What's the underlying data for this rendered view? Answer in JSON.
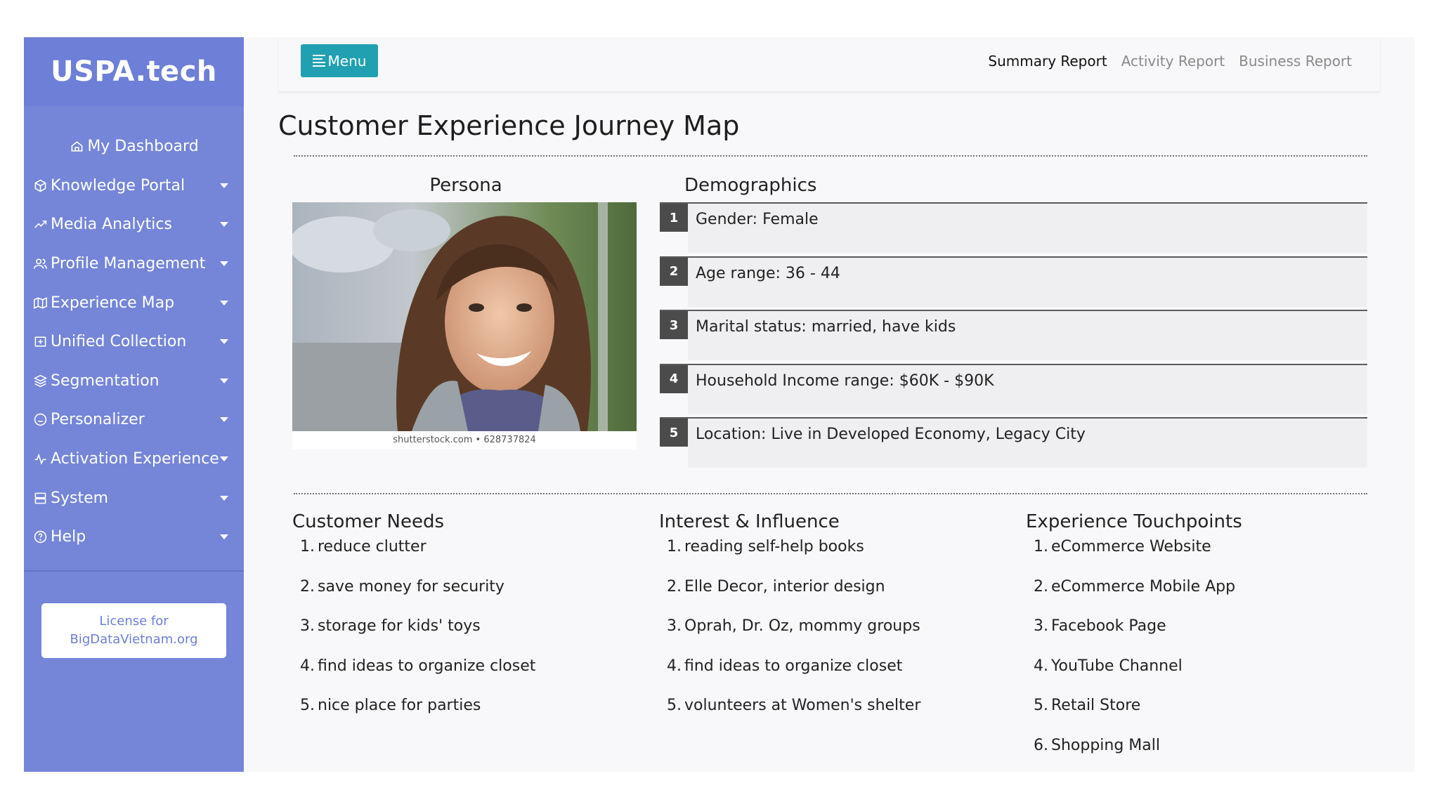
{
  "app": {
    "brand": "USPA.tech"
  },
  "sidebar": {
    "items": [
      {
        "label": "My Dashboard",
        "icon": "home-icon"
      },
      {
        "label": "Knowledge Portal",
        "icon": "cube-icon"
      },
      {
        "label": "Media Analytics",
        "icon": "trending-up-icon"
      },
      {
        "label": "Profile Management",
        "icon": "users-icon"
      },
      {
        "label": "Experience Map",
        "icon": "map-icon"
      },
      {
        "label": "Unified Collection",
        "icon": "collection-icon"
      },
      {
        "label": "Segmentation",
        "icon": "layers-icon"
      },
      {
        "label": "Personalizer",
        "icon": "smile-icon"
      },
      {
        "label": "Activation Experience",
        "icon": "activity-icon"
      },
      {
        "label": "System",
        "icon": "server-icon"
      },
      {
        "label": "Help",
        "icon": "help-icon"
      }
    ],
    "license": {
      "line1": "License for",
      "line2": "BigDataVietnam.org"
    }
  },
  "topbar": {
    "menu_label": "Menu",
    "tabs": [
      {
        "label": "Summary Report",
        "active": true
      },
      {
        "label": "Activity Report",
        "active": false
      },
      {
        "label": "Business Report",
        "active": false
      }
    ]
  },
  "main": {
    "title": "Customer Experience Journey Map",
    "persona": {
      "title": "Persona",
      "credit": "shutterstock.com • 628737824"
    },
    "demographics": {
      "title": "Demographics",
      "items": [
        {
          "num": "1",
          "text": "Gender: Female"
        },
        {
          "num": "2",
          "text": "Age range: 36 - 44"
        },
        {
          "num": "3",
          "text": "Marital status: married, have kids"
        },
        {
          "num": "4",
          "text": "Household Income range: $60K - $90K"
        },
        {
          "num": "5",
          "text": "Location: Live in Developed Economy, Legacy City"
        }
      ]
    },
    "needs": {
      "title": "Customer Needs",
      "items": [
        {
          "n": "1.",
          "text": "reduce clutter"
        },
        {
          "n": "2.",
          "text": "save money for security"
        },
        {
          "n": "3.",
          "text": "storage for kids' toys"
        },
        {
          "n": "4.",
          "text": "find ideas to organize closet"
        },
        {
          "n": "5.",
          "text": "nice place for parties"
        }
      ]
    },
    "interest": {
      "title": "Interest & Influence",
      "items": [
        {
          "n": "1.",
          "text": "reading self-help books"
        },
        {
          "n": "2.",
          "text": "Elle Decor, interior design"
        },
        {
          "n": "3.",
          "text": "Oprah, Dr. Oz, mommy groups"
        },
        {
          "n": "4.",
          "text": "find ideas to organize closet"
        },
        {
          "n": "5.",
          "text": "volunteers at Women's shelter"
        }
      ]
    },
    "touchpoints": {
      "title": "Experience Touchpoints",
      "items": [
        {
          "n": "1.",
          "text": "eCommerce Website"
        },
        {
          "n": "2.",
          "text": "eCommerce Mobile App"
        },
        {
          "n": "3.",
          "text": "Facebook Page"
        },
        {
          "n": "4.",
          "text": "YouTube Channel"
        },
        {
          "n": "5.",
          "text": "Retail Store"
        },
        {
          "n": "6.",
          "text": "Shopping Mall"
        }
      ]
    }
  },
  "colors": {
    "sidebar": "#7585d8",
    "brand_bar": "#6d7fd6",
    "menu_button": "#21a0b1",
    "number_badge": "#4b4b4b"
  }
}
